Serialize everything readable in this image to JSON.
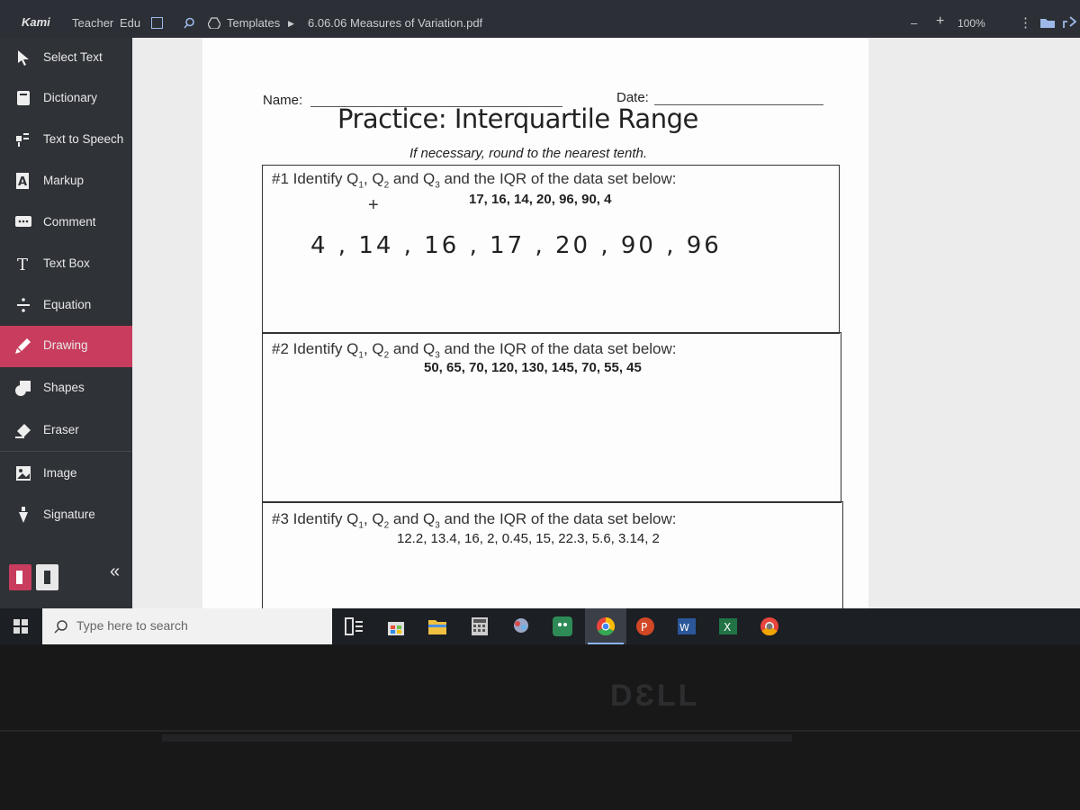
{
  "topbar": {
    "brand": "Kami",
    "plan": "Teacher",
    "edu": "Edu",
    "breadcrumb_folder": "Templates",
    "file_name": "6.06.06 Measures of Variation.pdf",
    "zoom_minus": "–",
    "zoom_plus": "+",
    "zoom": "100%",
    "more": "⋮"
  },
  "sidebar": {
    "items": [
      {
        "label": "Select Text",
        "icon": "cursor-icon"
      },
      {
        "label": "Dictionary",
        "icon": "book-icon"
      },
      {
        "label": "Text to Speech",
        "icon": "speech-icon"
      },
      {
        "label": "Markup",
        "icon": "markup-icon"
      },
      {
        "label": "Comment",
        "icon": "comment-icon"
      },
      {
        "label": "Text Box",
        "icon": "text-box-icon"
      },
      {
        "label": "Equation",
        "icon": "divide-icon"
      },
      {
        "label": "Drawing",
        "icon": "pencil-icon"
      },
      {
        "label": "Shapes",
        "icon": "shapes-icon"
      },
      {
        "label": "Eraser",
        "icon": "eraser-icon"
      },
      {
        "label": "Image",
        "icon": "image-icon"
      },
      {
        "label": "Signature",
        "icon": "pen-nib-icon"
      }
    ],
    "active": "Drawing",
    "collapse": "«"
  },
  "drawing_options": {
    "stroke_size": "1",
    "colors": {
      "cyan": "#5ad0da",
      "black": "#1e1e1e",
      "green": "#6ccc3a",
      "active_ring": "#c83d5e"
    }
  },
  "worksheet": {
    "name_label": "Name:",
    "date_label": "Date:",
    "title": "Practice: Interquartile Range",
    "instruction": "If necessary, round to the nearest tenth.",
    "problems": [
      {
        "prompt_pre": "#1 Identify Q",
        "prompt_post": " and the IQR of the data set below:",
        "data": "17, 16, 14, 20, 96, 90, 4"
      },
      {
        "prompt_pre": "#2 Identify Q",
        "prompt_post": " and the IQR of the data set below:",
        "data": "50, 65, 70, 120, 130, 145, 70, 55, 45"
      },
      {
        "prompt_pre": "#3 Identify Q",
        "prompt_post": " and the IQR of the data set below:",
        "data": "12.2, 13.4, 16, 2, 0.45, 15, 22.3, 5.6, 3.14, 2"
      }
    ],
    "sub1": "1",
    "sub2": "2",
    "sub3": "3",
    "and_q": ", Q",
    "and_q3": " and Q",
    "handwritten": "4 , 14 , 16 , 17 , 20 , 90 , 96",
    "cursor": "+"
  },
  "taskbar": {
    "search_placeholder": "Type here to search"
  },
  "bezel": {
    "logo": "DƐLL"
  }
}
